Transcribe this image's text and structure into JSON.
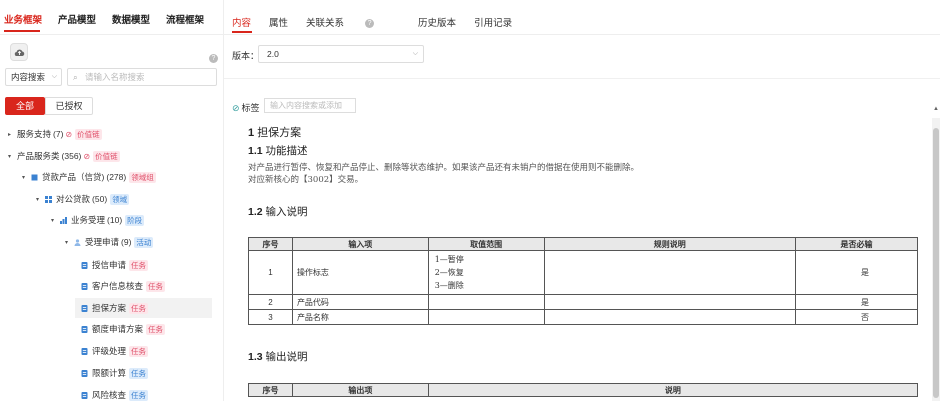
{
  "top_tabs": [
    "业务框架",
    "产品模型",
    "数据模型",
    "流程框架"
  ],
  "search": {
    "type": "内容搜索",
    "placeholder": "请输入名称搜索"
  },
  "filters": {
    "all": "全部",
    "authorized": "已授权"
  },
  "tree": [
    {
      "label": "服务支持",
      "count": "(7)",
      "tag": "价值链",
      "tag_style": "pink",
      "link": true
    },
    {
      "label": "产品服务类",
      "count": "(356)",
      "tag": "价值链",
      "tag_style": "pink",
      "link": true
    },
    {
      "label": "贷款产品（信贷)",
      "count": "(278)",
      "tag": "领域组",
      "tag_style": "pink",
      "link": false
    },
    {
      "label": "对公贷款",
      "count": "(50)",
      "tag": "领域",
      "tag_style": "blue",
      "link": false
    },
    {
      "label": "业务受理",
      "count": "(10)",
      "tag": "阶段",
      "tag_style": "blue",
      "link": false
    },
    {
      "label": "受理申请",
      "count": "(9)",
      "tag": "活动",
      "tag_style": "blue",
      "link": false
    },
    {
      "label": "授信申请",
      "count": "",
      "tag": "任务",
      "tag_style": "pink",
      "link": false
    },
    {
      "label": "客户信息核查",
      "count": "",
      "tag": "任务",
      "tag_style": "pink",
      "link": false
    },
    {
      "label": "担保方案",
      "count": "",
      "tag": "任务",
      "tag_style": "pink",
      "link": false
    },
    {
      "label": "额度申请方案",
      "count": "",
      "tag": "任务",
      "tag_style": "pink",
      "link": false
    },
    {
      "label": "评级处理",
      "count": "",
      "tag": "任务",
      "tag_style": "pink",
      "link": false
    },
    {
      "label": "限额计算",
      "count": "",
      "tag": "任务",
      "tag_style": "blue",
      "link": false
    },
    {
      "label": "风险核查",
      "count": "",
      "tag": "任务",
      "tag_style": "blue",
      "link": false
    }
  ],
  "right_tabs": [
    "内容",
    "属性",
    "关联关系",
    "历史版本",
    "引用记录"
  ],
  "version": {
    "label": "版本：",
    "value": "2.0"
  },
  "tags": {
    "label": "标签",
    "placeholder": "输入内容搜索或添加"
  },
  "doc": {
    "h1_num": "1",
    "h1": "担保方案",
    "h2_1_num": "1.1",
    "h2_1": "功能描述",
    "desc_1": "对产品进行暂停、恢复和产品停止、删除等状态维护。如果该产品还有未销户的借据在使用则不能删除。",
    "desc_2": "对应新核心的【3002】交易。",
    "h2_2_num": "1.2",
    "h2_2": "输入说明",
    "input_headers": [
      "序号",
      "输入项",
      "取值范围",
      "规则说明",
      "是否必输"
    ],
    "input_rows": [
      {
        "no": "1",
        "item": "操作标志",
        "range": [
          "1—暂停",
          "2—恢复",
          "3—删除"
        ],
        "rule": "",
        "req": "是"
      },
      {
        "no": "2",
        "item": "产品代码",
        "range": [],
        "rule": "",
        "req": "是"
      },
      {
        "no": "3",
        "item": "产品名称",
        "range": [],
        "rule": "",
        "req": "否"
      }
    ],
    "h2_3_num": "1.3",
    "h2_3": "输出说明",
    "output_headers": [
      "序号",
      "输出项",
      "说明"
    ]
  }
}
